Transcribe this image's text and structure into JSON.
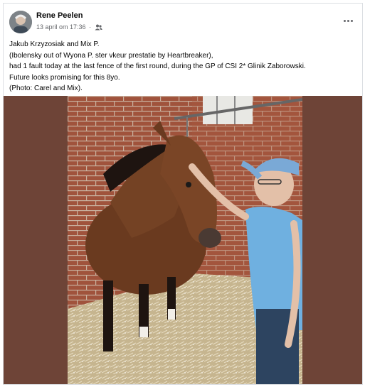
{
  "post": {
    "author": "Rene Peelen",
    "timestamp": "13 april om 17:36",
    "audience_icon": "friends-icon",
    "more_icon": "more-options-icon",
    "lines": [
      "Jakub Krzyzosiak and Mix P.",
      "(Ibolensky out of Wyona P. ster vkeur prestatie by Heartbreaker),",
      "had 1 fault today at the last fence of the first round, during  the GP of CSI 2* Glinik Zaborowski.",
      "Future looks promising for this 8yo.",
      "(Photo: Carel and Mix)."
    ]
  },
  "colors": {
    "frame": "#6e4437",
    "brick": "#9a4d38",
    "shirt": "#6fb0e0",
    "cap": "#7aa9d6",
    "horse": "#6a3a1f"
  }
}
